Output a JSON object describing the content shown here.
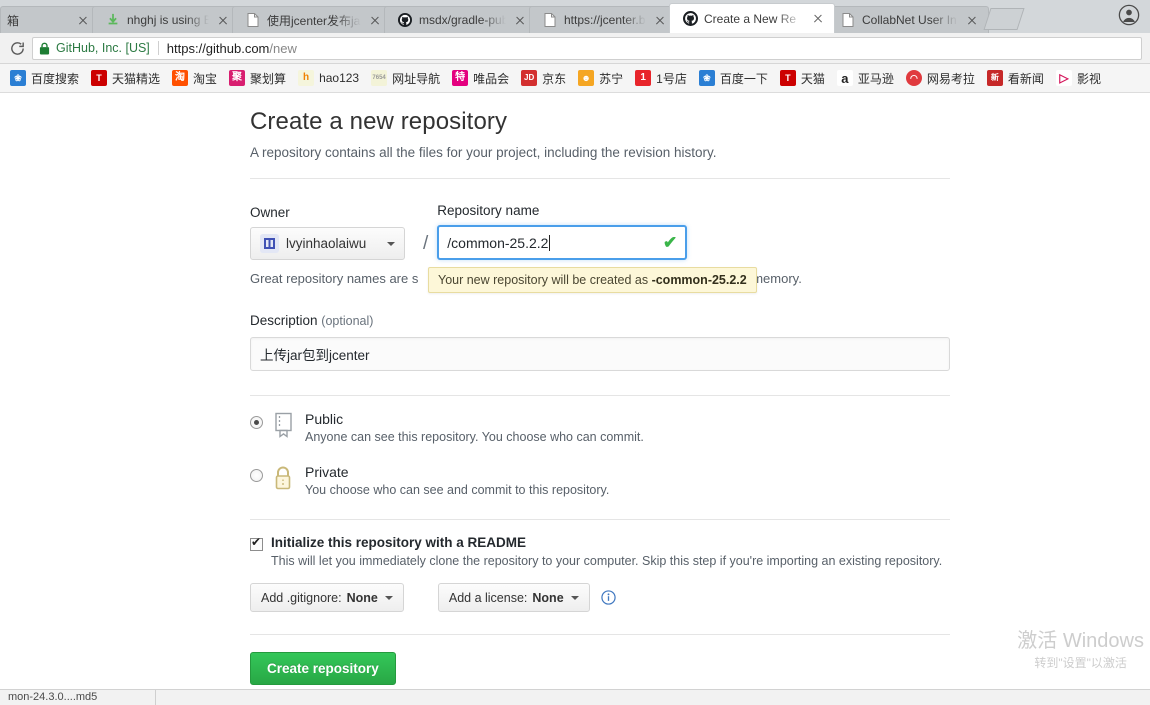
{
  "browser": {
    "tabs": [
      {
        "title": "箱",
        "favicon": "none",
        "active": false,
        "partial": true
      },
      {
        "title": "nhghj is using Bin",
        "favicon": "bintray-icon",
        "active": false
      },
      {
        "title": "使用jcenter发布ja",
        "favicon": "page-icon",
        "active": false
      },
      {
        "title": "msdx/gradle-pub",
        "favicon": "github-icon",
        "active": false
      },
      {
        "title": "https://jcenter.bi",
        "favicon": "page-icon",
        "active": false
      },
      {
        "title": "Create a New Re",
        "favicon": "github-icon",
        "active": true
      },
      {
        "title": "CollabNet User In",
        "favicon": "page-icon",
        "active": false
      }
    ],
    "omnibox": {
      "site_identity": "GitHub, Inc. [US]",
      "url_main": "https://github.com",
      "url_path": "/new"
    },
    "bookmarks": [
      {
        "label": "百度搜索",
        "icon": "baidu-icon",
        "color": "#2b7fd4",
        "glyph": "❀"
      },
      {
        "label": "天猫精选",
        "icon": "tmall-icon",
        "color": "#cc0000",
        "glyph": "T"
      },
      {
        "label": "淘宝",
        "icon": "taobao-icon",
        "color": "#ff5000",
        "glyph": "淘"
      },
      {
        "label": "聚划算",
        "icon": "juhuasuan-icon",
        "color": "#d81e70",
        "glyph": "聚"
      },
      {
        "label": "hao123",
        "icon": "hao123-icon",
        "color": "#f5f5dc",
        "glyph": "h"
      },
      {
        "label": "网址导航",
        "icon": "nav-icon",
        "color": "#f3f3d8",
        "glyph": "7654"
      },
      {
        "label": "唯品会",
        "icon": "vip-icon",
        "color": "#e4007f",
        "glyph": "特"
      },
      {
        "label": "京东",
        "icon": "jd-icon",
        "color": "#d32f2f",
        "glyph": "JD"
      },
      {
        "label": "苏宁",
        "icon": "suning-icon",
        "color": "#f5a623",
        "glyph": "苏"
      },
      {
        "label": "1号店",
        "icon": "yhd-icon",
        "color": "#e8252b",
        "glyph": "1"
      },
      {
        "label": "百度一下",
        "icon": "baidu2-icon",
        "color": "#2b7fd4",
        "glyph": "❀"
      },
      {
        "label": "天猫",
        "icon": "tmall2-icon",
        "color": "#cc0000",
        "glyph": "T"
      },
      {
        "label": "亚马逊",
        "icon": "amazon-icon",
        "color": "#ffffff",
        "glyph": "a"
      },
      {
        "label": "网易考拉",
        "icon": "kaola-icon",
        "color": "#e03a3e",
        "glyph": "◠"
      },
      {
        "label": "看新闻",
        "icon": "news-icon",
        "color": "#c62828",
        "glyph": "新"
      },
      {
        "label": "影视",
        "icon": "video-icon",
        "color": "#ffffff",
        "glyph": "▷"
      }
    ]
  },
  "page": {
    "title": "Create a new repository",
    "subtitle": "A repository contains all the files for your project, including the revision history.",
    "owner": {
      "label": "Owner",
      "name": "lvyinhaolaiwu",
      "separator": "/"
    },
    "repository": {
      "label": "Repository name",
      "value": "/common-25.2.2",
      "valid_icon": "✔",
      "hint": "Great repository names are short and memorable. Need inspiration? How about sturdy-memory.",
      "hint_prefix": "Great repository names are s",
      "hint_suffix": "rdy-memory.",
      "tooltip_prefix": "Your new repository will be created as",
      "tooltip_name": "-common-25.2.2"
    },
    "description": {
      "label": "Description",
      "optional": "(optional)",
      "value": "上传jar包到jcenter",
      "placeholder": ""
    },
    "visibility": [
      {
        "id": "public",
        "title": "Public",
        "description": "Anyone can see this repository. You choose who can commit.",
        "icon": "book-icon",
        "selected": true
      },
      {
        "id": "private",
        "title": "Private",
        "description": "You choose who can see and commit to this repository.",
        "icon": "lock-icon",
        "selected": false
      }
    ],
    "readme": {
      "label": "Initialize this repository with a README",
      "description": "This will let you immediately clone the repository to your computer. Skip this step if you're importing an existing repository.",
      "checked": true
    },
    "gitignore": {
      "prefix": "Add .gitignore:",
      "value": "None"
    },
    "license": {
      "prefix": "Add a license:",
      "value": "None"
    },
    "info_icon": "info-icon",
    "submit": "Create repository"
  },
  "watermark": {
    "line1": "激活 Windows",
    "line2": "转到\"设置\"以激活"
  },
  "downloadbar": {
    "item": "mon-24.3.0....md5"
  }
}
